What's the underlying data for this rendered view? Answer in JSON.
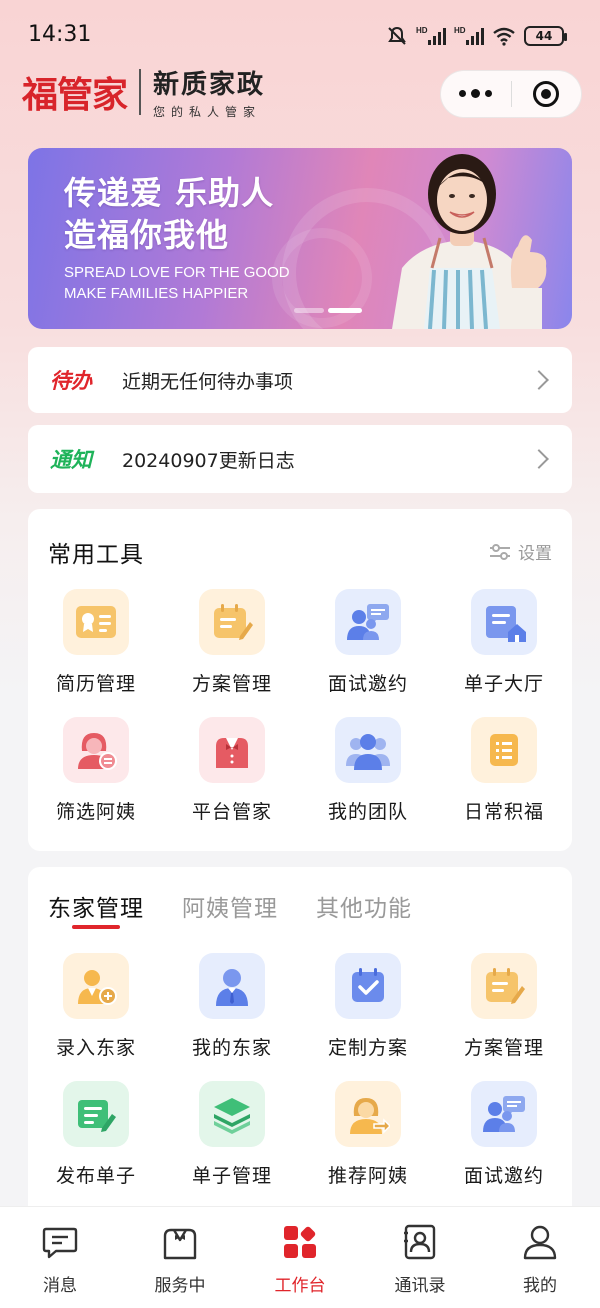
{
  "status_bar": {
    "time": "14:31",
    "battery": "44"
  },
  "header": {
    "logo_mark": "福管家",
    "brand_title": "新质家政",
    "brand_subtitle": "您的私人管家"
  },
  "banner": {
    "line1": "传递爱 乐助人",
    "line2": "造福你我他",
    "en_line1": "SPREAD LOVE FOR THE GOOD",
    "en_line2": "MAKE FAMILIES HAPPIER"
  },
  "todo": {
    "tag": "待办",
    "text": "近期无任何待办事项"
  },
  "notice": {
    "tag": "通知",
    "text": "20240907更新日志"
  },
  "tools": {
    "title": "常用工具",
    "settings_label": "设置",
    "items": [
      {
        "label": "简历管理",
        "icon": "resume-icon"
      },
      {
        "label": "方案管理",
        "icon": "plan-icon"
      },
      {
        "label": "面试邀约",
        "icon": "interview-icon"
      },
      {
        "label": "单子大厅",
        "icon": "order-hall-icon"
      },
      {
        "label": "筛选阿姨",
        "icon": "filter-nanny-icon"
      },
      {
        "label": "平台管家",
        "icon": "butler-icon"
      },
      {
        "label": "我的团队",
        "icon": "team-icon"
      },
      {
        "label": "日常积福",
        "icon": "daily-list-icon"
      }
    ]
  },
  "manage": {
    "tabs": [
      {
        "label": "东家管理"
      },
      {
        "label": "阿姨管理"
      },
      {
        "label": "其他功能"
      }
    ],
    "items": [
      {
        "label": "录入东家",
        "icon": "add-employer-icon"
      },
      {
        "label": "我的东家",
        "icon": "my-employer-icon"
      },
      {
        "label": "定制方案",
        "icon": "custom-plan-icon"
      },
      {
        "label": "方案管理",
        "icon": "plan-edit-icon"
      },
      {
        "label": "发布单子",
        "icon": "publish-order-icon"
      },
      {
        "label": "单子管理",
        "icon": "order-stack-icon"
      },
      {
        "label": "推荐阿姨",
        "icon": "recommend-nanny-icon"
      },
      {
        "label": "面试邀约",
        "icon": "interview-icon"
      }
    ]
  },
  "nav": {
    "items": [
      {
        "label": "消息",
        "icon": "message-icon"
      },
      {
        "label": "服务中",
        "icon": "service-icon"
      },
      {
        "label": "工作台",
        "icon": "workbench-icon"
      },
      {
        "label": "通讯录",
        "icon": "contacts-icon"
      },
      {
        "label": "我的",
        "icon": "profile-icon"
      }
    ],
    "active_index": 2,
    "active_color": "#e0252b"
  }
}
